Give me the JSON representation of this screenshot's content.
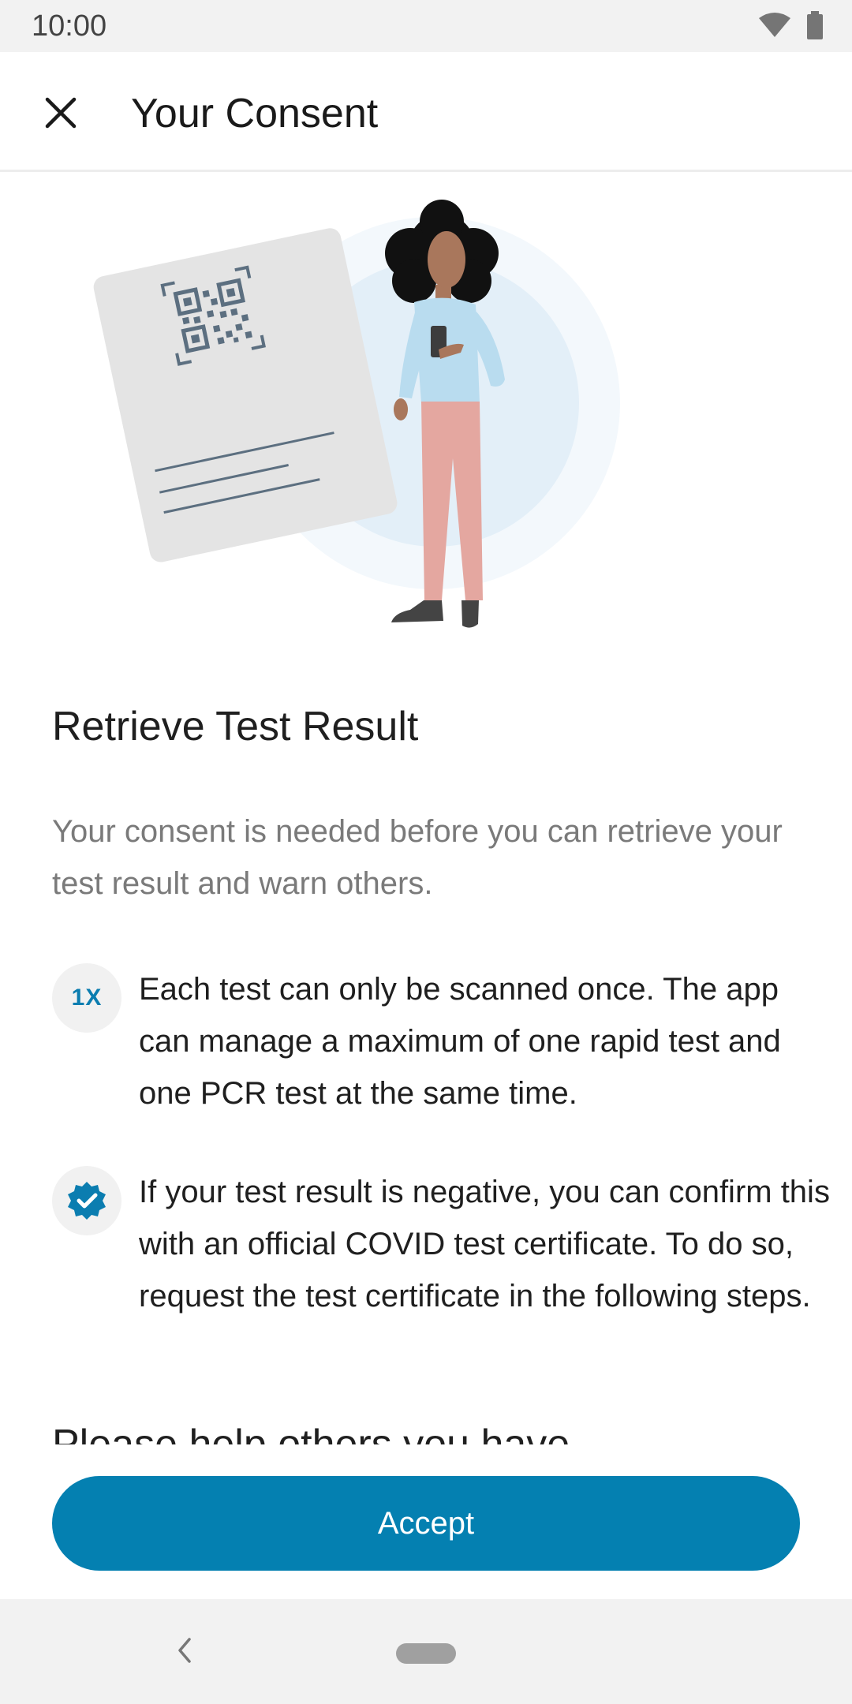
{
  "status_bar": {
    "time": "10:00",
    "icons": [
      "wifi-icon",
      "battery-icon"
    ]
  },
  "app_bar": {
    "title": "Your Consent",
    "close_icon": "close-icon"
  },
  "content": {
    "heading": "Retrieve Test Result",
    "intro": "Your consent is needed before you can retrieve your test result and warn others.",
    "items": [
      {
        "badge": "1X",
        "icon": "once-badge-icon",
        "text": "Each test can only be scanned once. The app can manage a maximum of one rapid test and one PCR test at the same time."
      },
      {
        "icon": "verified-check-icon",
        "text": "If your test result is negative, you can confirm this with an official COVID test certificate. To do so, request the test certificate in the following steps."
      }
    ],
    "next_heading": "Please help others you have"
  },
  "footer": {
    "accept_label": "Accept"
  },
  "colors": {
    "accent": "#0480b1",
    "text_primary": "#1f1f1f",
    "text_secondary": "#7a7a7a"
  }
}
